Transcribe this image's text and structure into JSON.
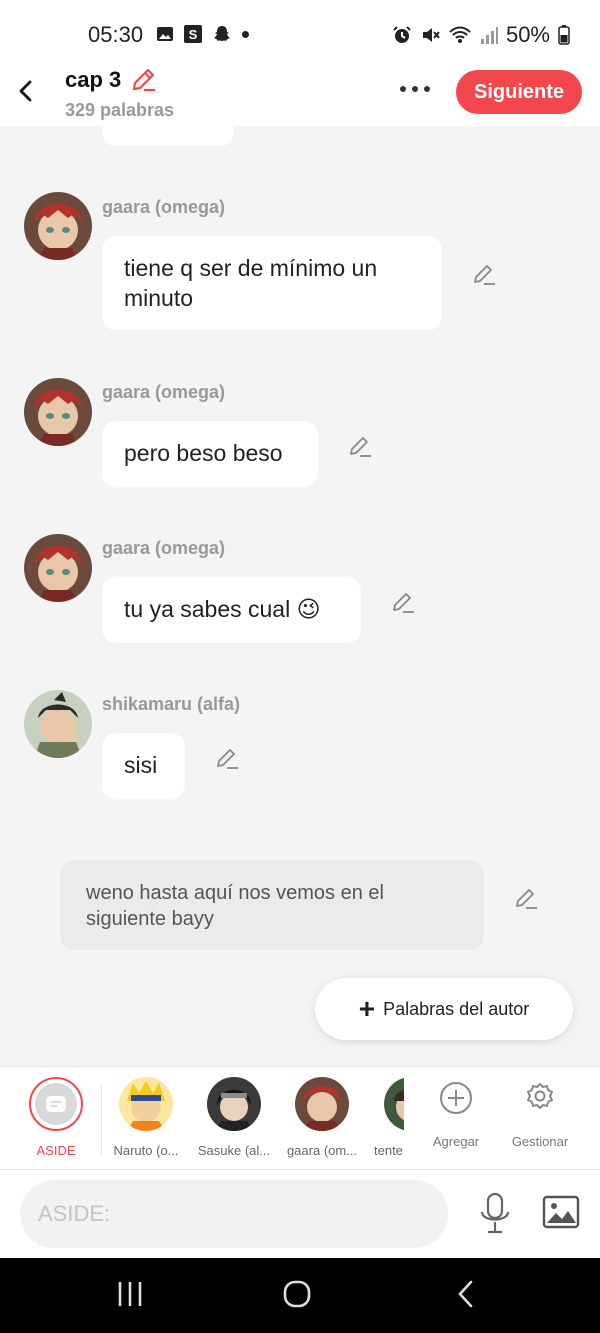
{
  "status_bar": {
    "time": "05:30",
    "s_badge": "S",
    "battery": "50%"
  },
  "header": {
    "title": "cap 3",
    "word_count": "329 palabras",
    "next_button": "Siguiente"
  },
  "messages": [
    {
      "name": "gaara (omega)",
      "text_line1": "tiene q ser de mínimo un",
      "text_line2": "minuto"
    },
    {
      "name": "gaara (omega)",
      "text": "pero beso beso"
    },
    {
      "name": "gaara (omega)",
      "text": "tu ya sabes cual",
      "emoji": "😉"
    },
    {
      "name": "shikamaru (alfa)",
      "text": "sisi"
    }
  ],
  "narration": {
    "line1": "weno hasta aquí nos vemos en el",
    "line2": "siguiente bayy"
  },
  "author_button": {
    "icon": "+",
    "label": "Palabras del autor"
  },
  "character_bar": {
    "aside": "ASIDE",
    "characters": [
      "Naruto (o...",
      "Sasuke (al...",
      "gaara (om...",
      "tente"
    ],
    "add": "Agregar",
    "manage": "Gestionar"
  },
  "input": {
    "placeholder": "ASIDE:"
  },
  "colors": {
    "accent": "#f2484d",
    "background": "#f4f4f4"
  }
}
